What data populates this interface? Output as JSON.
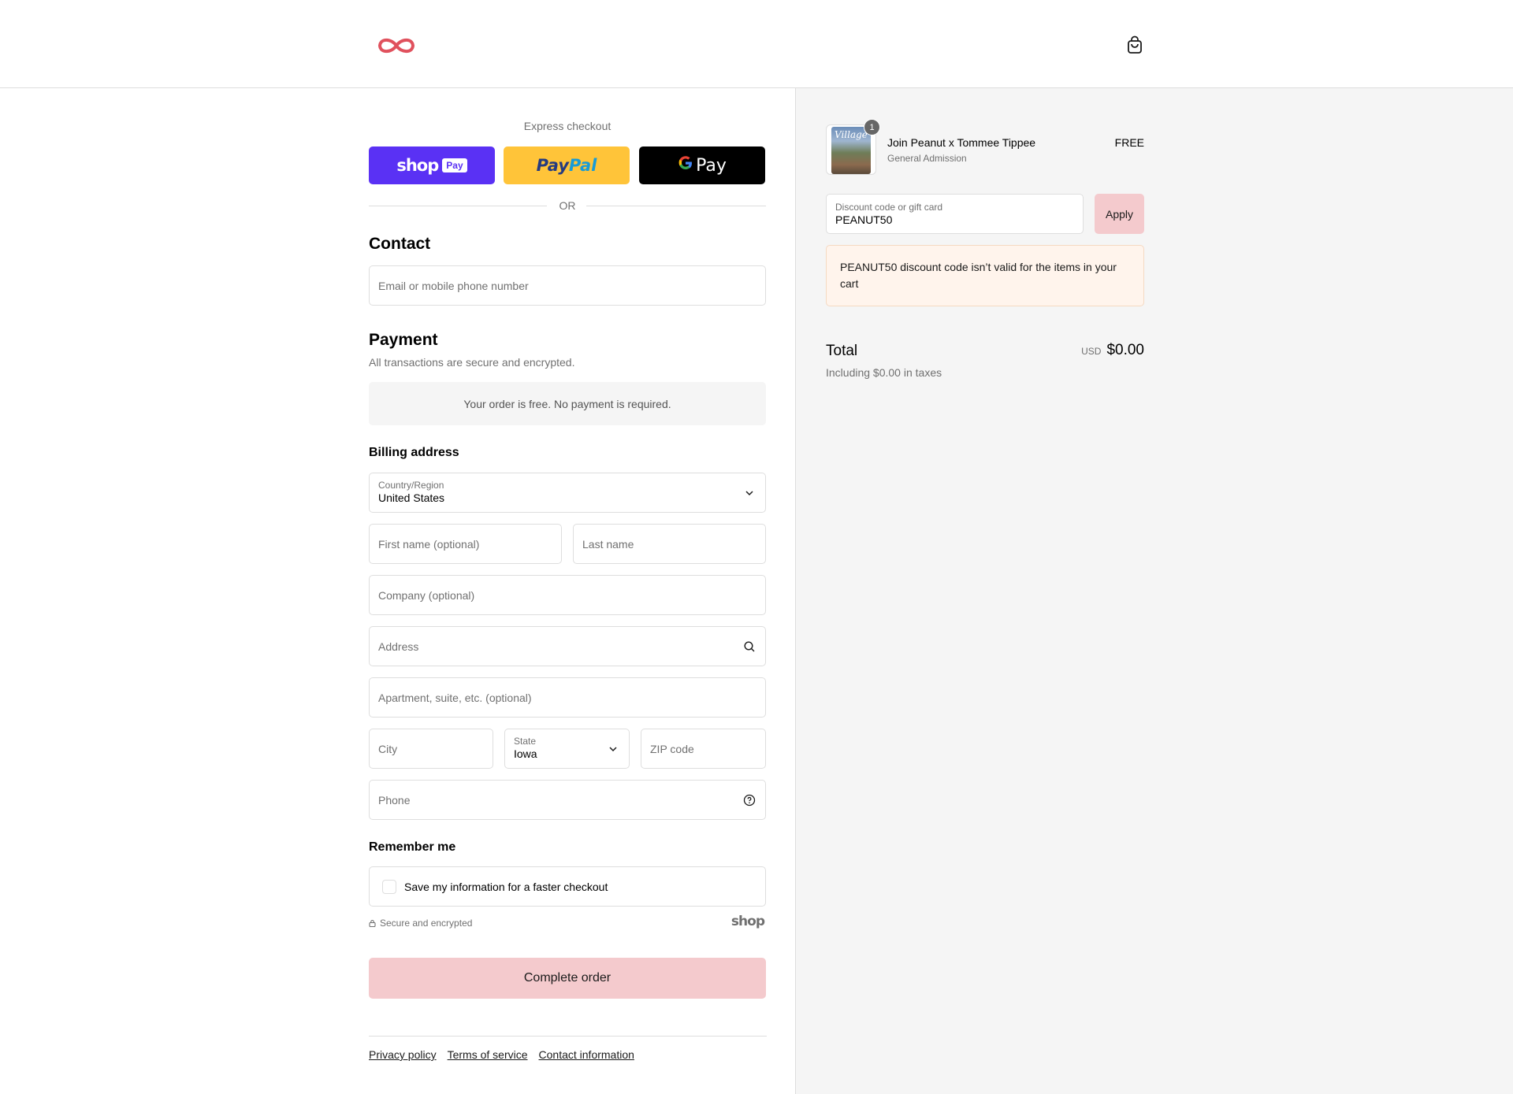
{
  "header": {
    "brand_icon": "infinity-logo",
    "cart_icon": "shopping-bag-icon"
  },
  "express": {
    "title": "Express checkout",
    "shop_pay_word": "shop",
    "shop_pay_badge": "Pay",
    "paypal_part1": "Pay",
    "paypal_part2": "Pal",
    "gpay_g": "G",
    "gpay_pay": "Pay",
    "or": "OR"
  },
  "contact": {
    "title": "Contact",
    "email_placeholder": "Email or mobile phone number"
  },
  "payment": {
    "title": "Payment",
    "subtitle": "All transactions are secure and encrypted.",
    "free_message": "Your order is free. No payment is required."
  },
  "billing": {
    "title": "Billing address",
    "country_label": "Country/Region",
    "country_value": "United States",
    "first_name_placeholder": "First name (optional)",
    "last_name_placeholder": "Last name",
    "company_placeholder": "Company (optional)",
    "address_placeholder": "Address",
    "apartment_placeholder": "Apartment, suite, etc. (optional)",
    "city_placeholder": "City",
    "state_label": "State",
    "state_value": "Iowa",
    "zip_placeholder": "ZIP code",
    "phone_placeholder": "Phone"
  },
  "remember": {
    "title": "Remember me",
    "checkbox_label": "Save my information for a faster checkout",
    "secure_text": "Secure and encrypted",
    "shop_mark": "shop"
  },
  "actions": {
    "complete_order": "Complete order"
  },
  "footer": {
    "links": [
      "Privacy policy",
      "Terms of service",
      "Contact information"
    ]
  },
  "summary": {
    "product": {
      "name": "Join Peanut x Tommee Tippee",
      "variant": "General Admission",
      "price": "FREE",
      "quantity": "1",
      "thumb_text": "Village"
    },
    "discount": {
      "label": "Discount code or gift card",
      "value": "PEANUT50",
      "apply": "Apply"
    },
    "error": "PEANUT50 discount code isn’t valid for the items in your cart",
    "total_label": "Total",
    "tax_note": "Including $0.00 in taxes",
    "currency": "USD",
    "total_amount": "$0.00"
  },
  "colors": {
    "brand_accent": "#e0515d",
    "shop_pay": "#5a31f4",
    "paypal": "#ffc439",
    "gpay": "#000000",
    "cta": "#f4cacd",
    "error_bg": "#fff4ec"
  }
}
